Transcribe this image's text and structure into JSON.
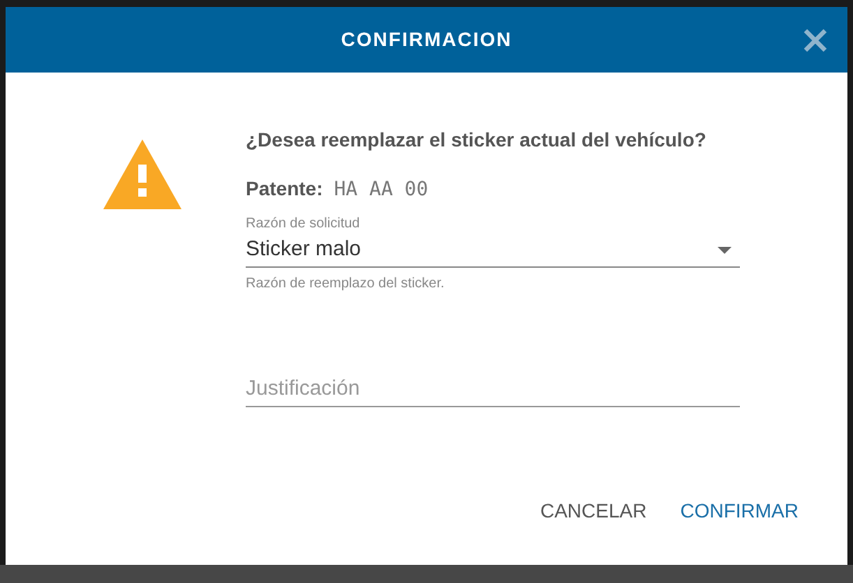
{
  "dialog": {
    "title": "CONFIRMACION",
    "question": "¿Desea reemplazar el sticker actual del vehículo?",
    "plate": {
      "label": "Patente:",
      "value": "HA AA 00"
    },
    "reason": {
      "label": "Razón de solicitud",
      "value": "Sticker malo",
      "helper": "Razón de reemplazo del sticker."
    },
    "justification": {
      "placeholder": "Justificación"
    },
    "buttons": [
      {
        "label": "CANCELAR",
        "kind": "secondary"
      },
      {
        "label": "CONFIRMAR",
        "kind": "primary"
      }
    ]
  }
}
